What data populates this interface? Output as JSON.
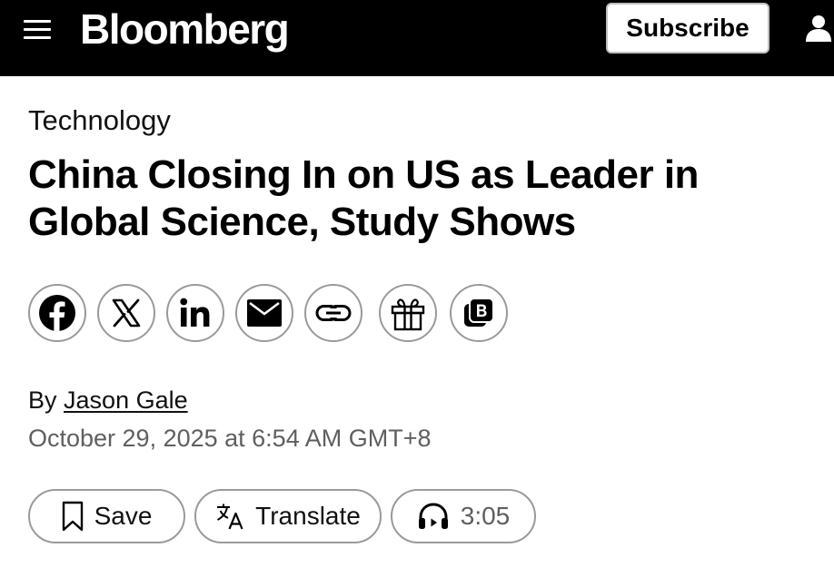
{
  "header": {
    "logo": "Bloomberg",
    "subscribe_label": "Subscribe",
    "icons": [
      "menu-icon",
      "account-icon"
    ]
  },
  "article": {
    "section": "Technology",
    "headline": "China Closing In on US as Leader in Global Science, Study Shows",
    "byline_prefix": "By",
    "author": "Jason Gale",
    "timestamp": "October 29, 2025 at 6:54 AM GMT+8"
  },
  "share_icons": [
    "facebook-icon",
    "x-icon",
    "linkedin-icon",
    "email-icon",
    "link-icon",
    "gift-icon",
    "bloomberg-app-icon"
  ],
  "actions": {
    "save_label": "Save",
    "translate_label": "Translate",
    "listen_duration": "3:05"
  },
  "colors": {
    "header_bg": "#000000",
    "text": "#000000",
    "muted_text": "#5f5f5f",
    "border": "#9a9a9a"
  }
}
